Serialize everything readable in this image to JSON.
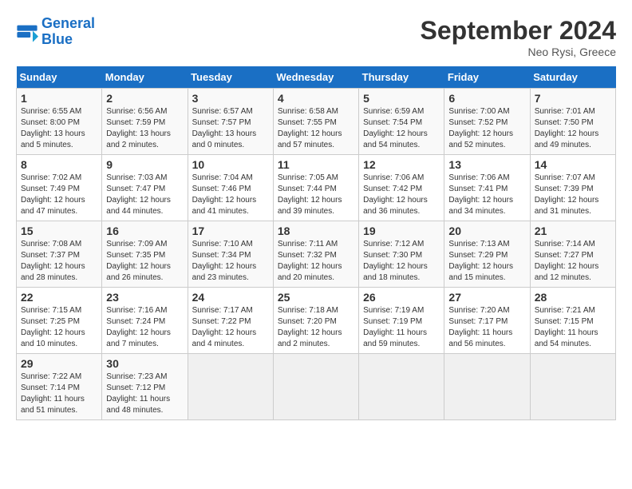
{
  "header": {
    "logo_line1": "General",
    "logo_line2": "Blue",
    "month": "September 2024",
    "location": "Neo Rysi, Greece"
  },
  "days_of_week": [
    "Sunday",
    "Monday",
    "Tuesday",
    "Wednesday",
    "Thursday",
    "Friday",
    "Saturday"
  ],
  "weeks": [
    [
      {
        "day": 1,
        "info": "Sunrise: 6:55 AM\nSunset: 8:00 PM\nDaylight: 13 hours\nand 5 minutes."
      },
      {
        "day": 2,
        "info": "Sunrise: 6:56 AM\nSunset: 7:59 PM\nDaylight: 13 hours\nand 2 minutes."
      },
      {
        "day": 3,
        "info": "Sunrise: 6:57 AM\nSunset: 7:57 PM\nDaylight: 13 hours\nand 0 minutes."
      },
      {
        "day": 4,
        "info": "Sunrise: 6:58 AM\nSunset: 7:55 PM\nDaylight: 12 hours\nand 57 minutes."
      },
      {
        "day": 5,
        "info": "Sunrise: 6:59 AM\nSunset: 7:54 PM\nDaylight: 12 hours\nand 54 minutes."
      },
      {
        "day": 6,
        "info": "Sunrise: 7:00 AM\nSunset: 7:52 PM\nDaylight: 12 hours\nand 52 minutes."
      },
      {
        "day": 7,
        "info": "Sunrise: 7:01 AM\nSunset: 7:50 PM\nDaylight: 12 hours\nand 49 minutes."
      }
    ],
    [
      {
        "day": 8,
        "info": "Sunrise: 7:02 AM\nSunset: 7:49 PM\nDaylight: 12 hours\nand 47 minutes."
      },
      {
        "day": 9,
        "info": "Sunrise: 7:03 AM\nSunset: 7:47 PM\nDaylight: 12 hours\nand 44 minutes."
      },
      {
        "day": 10,
        "info": "Sunrise: 7:04 AM\nSunset: 7:46 PM\nDaylight: 12 hours\nand 41 minutes."
      },
      {
        "day": 11,
        "info": "Sunrise: 7:05 AM\nSunset: 7:44 PM\nDaylight: 12 hours\nand 39 minutes."
      },
      {
        "day": 12,
        "info": "Sunrise: 7:06 AM\nSunset: 7:42 PM\nDaylight: 12 hours\nand 36 minutes."
      },
      {
        "day": 13,
        "info": "Sunrise: 7:06 AM\nSunset: 7:41 PM\nDaylight: 12 hours\nand 34 minutes."
      },
      {
        "day": 14,
        "info": "Sunrise: 7:07 AM\nSunset: 7:39 PM\nDaylight: 12 hours\nand 31 minutes."
      }
    ],
    [
      {
        "day": 15,
        "info": "Sunrise: 7:08 AM\nSunset: 7:37 PM\nDaylight: 12 hours\nand 28 minutes."
      },
      {
        "day": 16,
        "info": "Sunrise: 7:09 AM\nSunset: 7:35 PM\nDaylight: 12 hours\nand 26 minutes."
      },
      {
        "day": 17,
        "info": "Sunrise: 7:10 AM\nSunset: 7:34 PM\nDaylight: 12 hours\nand 23 minutes."
      },
      {
        "day": 18,
        "info": "Sunrise: 7:11 AM\nSunset: 7:32 PM\nDaylight: 12 hours\nand 20 minutes."
      },
      {
        "day": 19,
        "info": "Sunrise: 7:12 AM\nSunset: 7:30 PM\nDaylight: 12 hours\nand 18 minutes."
      },
      {
        "day": 20,
        "info": "Sunrise: 7:13 AM\nSunset: 7:29 PM\nDaylight: 12 hours\nand 15 minutes."
      },
      {
        "day": 21,
        "info": "Sunrise: 7:14 AM\nSunset: 7:27 PM\nDaylight: 12 hours\nand 12 minutes."
      }
    ],
    [
      {
        "day": 22,
        "info": "Sunrise: 7:15 AM\nSunset: 7:25 PM\nDaylight: 12 hours\nand 10 minutes."
      },
      {
        "day": 23,
        "info": "Sunrise: 7:16 AM\nSunset: 7:24 PM\nDaylight: 12 hours\nand 7 minutes."
      },
      {
        "day": 24,
        "info": "Sunrise: 7:17 AM\nSunset: 7:22 PM\nDaylight: 12 hours\nand 4 minutes."
      },
      {
        "day": 25,
        "info": "Sunrise: 7:18 AM\nSunset: 7:20 PM\nDaylight: 12 hours\nand 2 minutes."
      },
      {
        "day": 26,
        "info": "Sunrise: 7:19 AM\nSunset: 7:19 PM\nDaylight: 11 hours\nand 59 minutes."
      },
      {
        "day": 27,
        "info": "Sunrise: 7:20 AM\nSunset: 7:17 PM\nDaylight: 11 hours\nand 56 minutes."
      },
      {
        "day": 28,
        "info": "Sunrise: 7:21 AM\nSunset: 7:15 PM\nDaylight: 11 hours\nand 54 minutes."
      }
    ],
    [
      {
        "day": 29,
        "info": "Sunrise: 7:22 AM\nSunset: 7:14 PM\nDaylight: 11 hours\nand 51 minutes."
      },
      {
        "day": 30,
        "info": "Sunrise: 7:23 AM\nSunset: 7:12 PM\nDaylight: 11 hours\nand 48 minutes."
      },
      null,
      null,
      null,
      null,
      null
    ]
  ]
}
